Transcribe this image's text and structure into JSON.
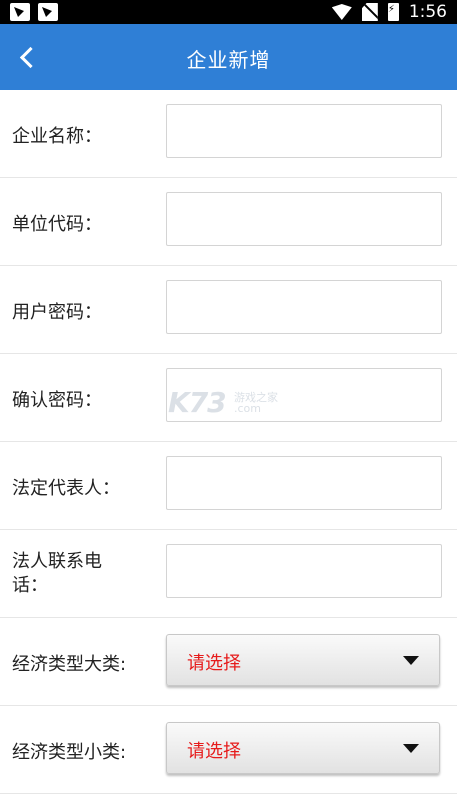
{
  "status_bar": {
    "time": "1:56",
    "left_icons": [
      "notification-icon",
      "notification-icon"
    ],
    "right_icons": [
      "wifi-icon",
      "no-sim-icon",
      "battery-charging-icon"
    ]
  },
  "header": {
    "title": "企业新增",
    "back_icon": "chevron-left-icon",
    "color": "#2f7fd6"
  },
  "form": {
    "company_name_label": "企业名称：",
    "company_name_value": "",
    "unit_code_label": "单位代码：",
    "unit_code_value": "",
    "user_password_label": "用户密码：",
    "user_password_value": "",
    "confirm_password_label": "确认密码：",
    "confirm_password_value": "",
    "legal_rep_label": "法定代表人：",
    "legal_rep_value": "",
    "legal_phone_label_line1": "法人联系电",
    "legal_phone_label_line2": "话：",
    "legal_phone_value": "",
    "econ_major_label": "经济类型大类:",
    "econ_major_value": "请选择",
    "econ_minor_label": "经济类型小类:",
    "econ_minor_value": "请选择",
    "select_text_color": "#e61b1b"
  },
  "watermark": {
    "logo": "K73",
    "line1": "游戏之家",
    "line2": ".com"
  }
}
